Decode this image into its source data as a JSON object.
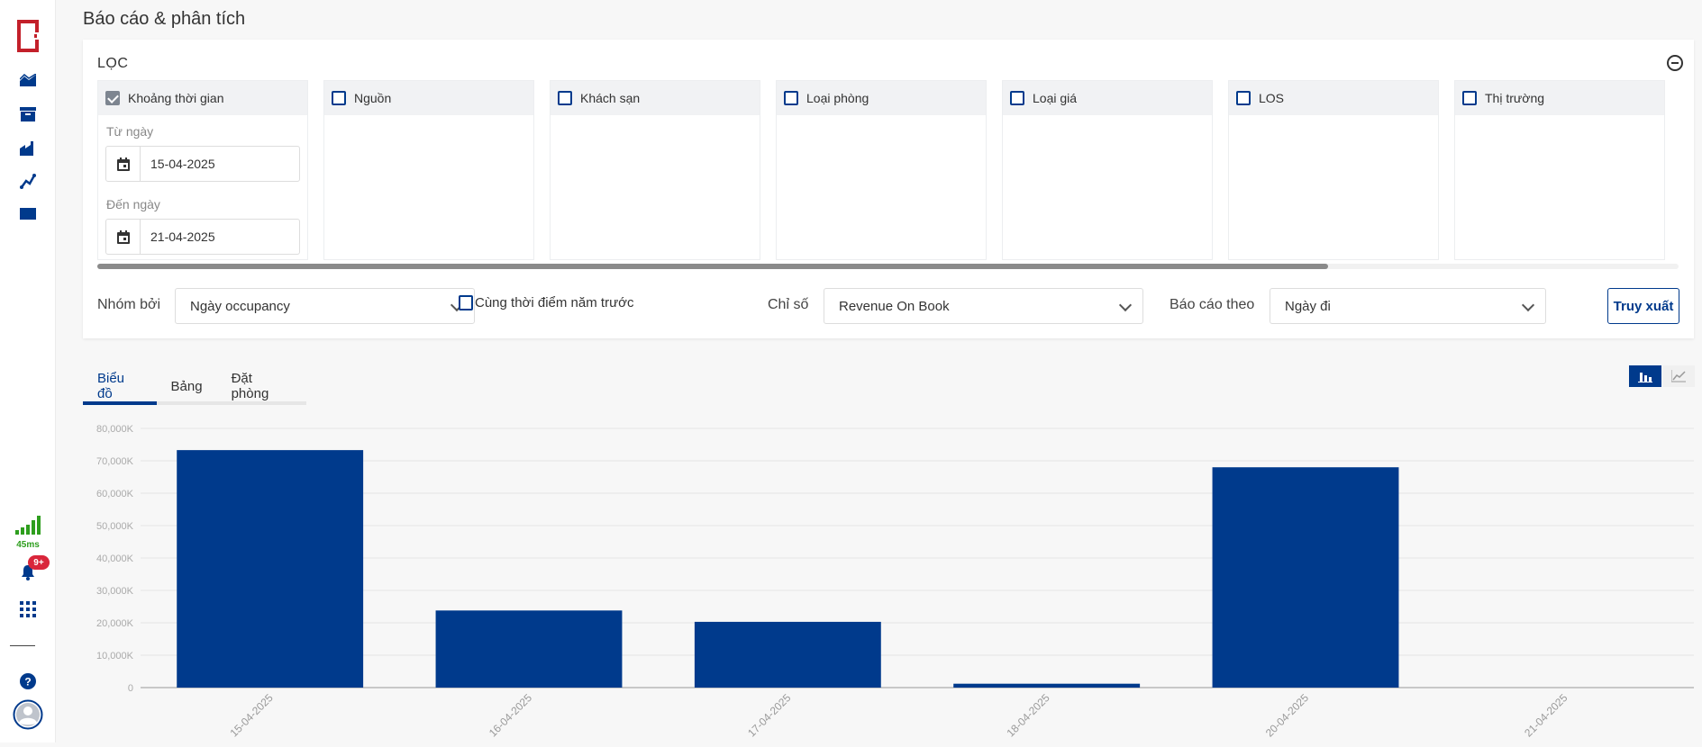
{
  "page": {
    "title": "Báo cáo & phân tích"
  },
  "sidebar": {
    "icons": [
      "logo-icon",
      "chart-area-icon",
      "archive-icon",
      "factory-icon",
      "line-trend-icon",
      "book-icon"
    ],
    "latency": "45ms",
    "notification_badge": "9+"
  },
  "filter": {
    "title": "LỌC",
    "panels": [
      {
        "label": "Khoảng thời gian",
        "checked": true
      },
      {
        "label": "Nguồn",
        "checked": false
      },
      {
        "label": "Khách sạn",
        "checked": false
      },
      {
        "label": "Loại phòng",
        "checked": false
      },
      {
        "label": "Loại giá",
        "checked": false
      },
      {
        "label": "LOS",
        "checked": false
      },
      {
        "label": "Thị trường",
        "checked": false
      }
    ],
    "from_label": "Từ ngày",
    "from_value": "15-04-2025",
    "to_label": "Đến ngày",
    "to_value": "21-04-2025",
    "group_by_label": "Nhóm bởi",
    "group_by_value": "Ngày occupancy",
    "yoy_label": "Cùng thời điểm năm trước",
    "metric_label": "Chỉ số",
    "metric_value": "Revenue On Book",
    "report_by_label": "Báo cáo theo",
    "report_by_value": "Ngày đi",
    "submit_label": "Truy xuất"
  },
  "tabs": [
    {
      "label": "Biểu đồ",
      "active": true
    },
    {
      "label": "Bảng",
      "active": false
    },
    {
      "label": "Đặt phòng",
      "active": false
    }
  ],
  "colors": {
    "bar": "#003a8c",
    "accent": "#003a8c",
    "signal": "#2e9e1e",
    "badge": "#d9263b",
    "logo": "#c3202a"
  },
  "chart_data": {
    "type": "bar",
    "categories": [
      "15-04-2025",
      "16-04-2025",
      "17-04-2025",
      "18-04-2025",
      "20-04-2025",
      "21-04-2025"
    ],
    "values": [
      73300,
      23800,
      20300,
      1200,
      68000,
      0
    ],
    "y_ticks": [
      "0",
      "10,000K",
      "20,000K",
      "30,000K",
      "40,000K",
      "50,000K",
      "60,000K",
      "70,000K",
      "80,000K"
    ],
    "ylim": [
      0,
      80000
    ],
    "grid": true
  }
}
